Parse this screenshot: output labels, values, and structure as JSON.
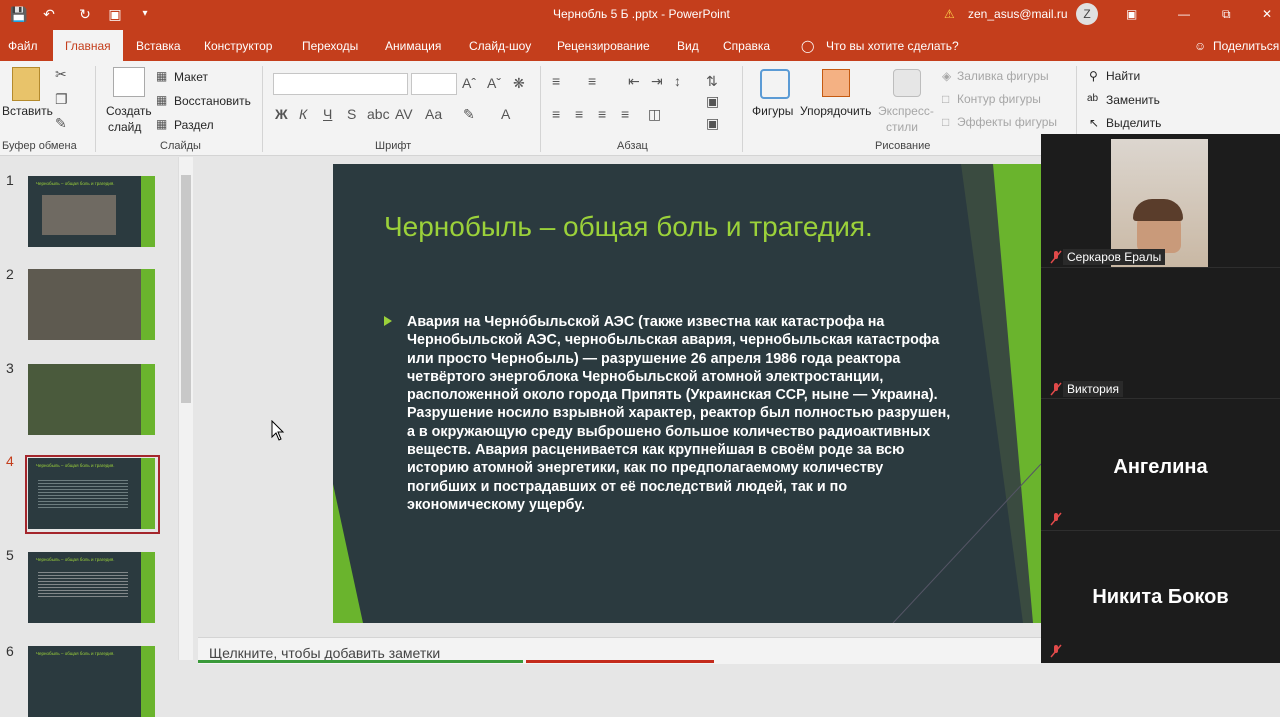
{
  "titlebar": {
    "doc_title": "Чернобль 5 Б .pptx  -  PowerPoint",
    "account": "zen_asus@mail.ru",
    "avatar_letter": "Z"
  },
  "tabs": [
    "Файл",
    "Главная",
    "Вставка",
    "Конструктор",
    "Переходы",
    "Анимация",
    "Слайд-шоу",
    "Рецензирование",
    "Вид",
    "Справка"
  ],
  "tell_me": "Что вы хотите сделать?",
  "share": "Поделиться",
  "ribbon": {
    "paste": "Вставить",
    "new_slide_1": "Создать",
    "new_slide_2": "слайд",
    "layout": "Макет",
    "reset": "Восстановить",
    "section": "Раздел",
    "shapes": "Фигуры",
    "arrange": "Упорядочить",
    "quick_styles_1": "Экспресс-",
    "quick_styles_2": "стили",
    "shape_fill": "Заливка фигуры",
    "shape_outline": "Контур фигуры",
    "shape_effects": "Эффекты фигуры",
    "find": "Найти",
    "replace": "Заменить",
    "select": "Выделить",
    "groups": {
      "clipboard": "Буфер обмена",
      "slides": "Слайды",
      "font": "Шрифт",
      "paragraph": "Абзац",
      "drawing": "Рисование"
    }
  },
  "thumbnails": [
    {
      "num": "1",
      "title": "Чернобыль – общая боль и трагедия."
    },
    {
      "num": "2",
      "title": ""
    },
    {
      "num": "3",
      "title": ""
    },
    {
      "num": "4",
      "title": "Чернобыль – общая боль и трагедия."
    },
    {
      "num": "5",
      "title": "Чернобыль – общая боль и трагедия."
    },
    {
      "num": "6",
      "title": "Чернобыль – общая боль и трагедия."
    }
  ],
  "slide": {
    "title": "Чернобыль – общая боль и трагедия.",
    "body": "Авария на Черно́быльской АЭС (также известна как катастрофа на Чернобыльской АЭС, чернобыльская авария, чернобыльская катастрофа или просто Чернобыль) — разрушение 26 апреля 1986 года реактора четвёртого энергоблока Чернобыльской атомной электростанции, расположенной около города Припять (Украинская ССР, ныне — Украина). Разрушение носило взрывной характер, реактор был полностью разрушен, а в окружающую среду выброшено большое количество радиоактивных веществ. Авария расценивается как крупнейшая в своём роде за всю историю атомной энергетики, как по предполагаемому количеству погибших и пострадавших от её последствий людей, так и по экономическому ущербу."
  },
  "notes_placeholder": "Щелкните, чтобы добавить заметки",
  "participants": [
    {
      "name": "Серкаров Ералы"
    },
    {
      "name": "Виктория"
    },
    {
      "name": "Ангелина"
    },
    {
      "name": "Никита Боков"
    }
  ],
  "colors": {
    "accent": "#c43e1c",
    "slide_bg": "#2b3a3f",
    "slide_green": "#9bd13a"
  }
}
